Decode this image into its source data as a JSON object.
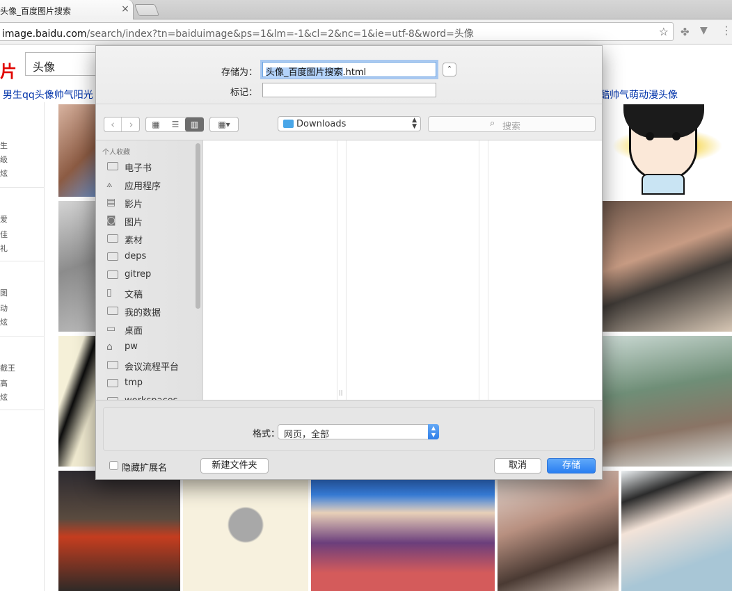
{
  "browser": {
    "tab_title": "头像_百度图片搜索",
    "tab_close": "×",
    "url_host": "image.baidu.com",
    "url_rest": "/search/index?tn=baiduimage&ps=1&lm=-1&cl=2&nc=1&ie=utf-8&word=头像",
    "star": "☆"
  },
  "page": {
    "logo": "片",
    "search_value": "头像",
    "related_left": "男生qq头像帅气阳光",
    "related_right": "酷帅气萌动漫头像",
    "left_fragments": [
      "生",
      "级",
      "炫",
      "爱",
      "佳",
      "礼",
      "图",
      "动",
      "炫",
      "截王",
      "高",
      "炫"
    ]
  },
  "dialog": {
    "save_as_label": "存储为：",
    "filename_selected": "头像_百度图片搜索",
    "filename_ext": ".html",
    "tags_label": "标记：",
    "tags_value": "",
    "expand": "⌃",
    "location": "Downloads",
    "search_placeholder": "搜索",
    "sidebar_header": "个人收藏",
    "sidebar_items": [
      "电子书",
      "应用程序",
      "影片",
      "图片",
      "素材",
      "deps",
      "gitrep",
      "文稿",
      "我的数据",
      "桌面",
      "pw",
      "会议流程平台",
      "tmp",
      "workspaces"
    ],
    "format_label": "格式：",
    "format_value": "网页，全部",
    "hide_ext_label": "隐藏扩展名",
    "new_folder": "新建文件夹",
    "cancel": "取消",
    "save": "存储"
  },
  "colors": {
    "accent": "#2a7ff1",
    "selection": "#b3d3fb",
    "baidu_red": "#e10602",
    "link": "#0033aa"
  }
}
